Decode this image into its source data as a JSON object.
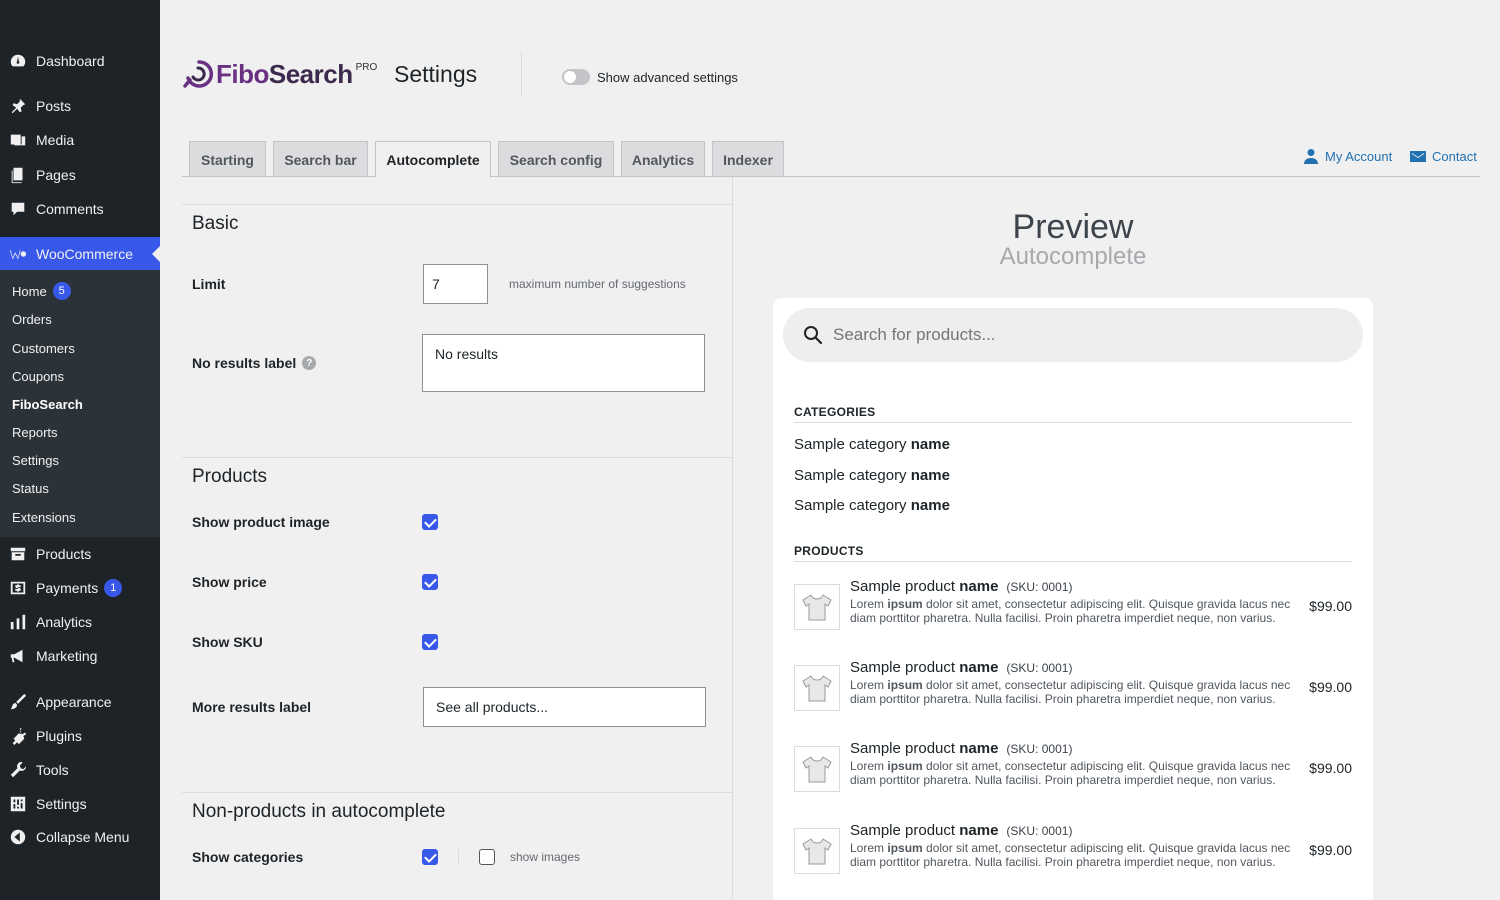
{
  "sidebar": {
    "items": [
      {
        "label": "Dashboard",
        "icon": "dashboard-icon"
      },
      {
        "label": "Posts",
        "icon": "pin-icon"
      },
      {
        "label": "Media",
        "icon": "media-icon"
      },
      {
        "label": "Pages",
        "icon": "pages-icon"
      },
      {
        "label": "Comments",
        "icon": "comment-icon"
      },
      {
        "label": "WooCommerce",
        "icon": "woo-icon"
      },
      {
        "label": "Products",
        "icon": "archive-icon"
      },
      {
        "label": "Payments",
        "icon": "dollar-icon",
        "badge": "1"
      },
      {
        "label": "Analytics",
        "icon": "bar-chart-icon"
      },
      {
        "label": "Marketing",
        "icon": "megaphone-icon"
      },
      {
        "label": "Appearance",
        "icon": "paint-brush-icon"
      },
      {
        "label": "Plugins",
        "icon": "plug-icon"
      },
      {
        "label": "Tools",
        "icon": "wrench-icon"
      },
      {
        "label": "Settings",
        "icon": "sliders-icon"
      },
      {
        "label": "Collapse Menu",
        "icon": "collapse-icon"
      }
    ],
    "submenu": [
      {
        "label": "Home",
        "badge": "5"
      },
      {
        "label": "Orders"
      },
      {
        "label": "Customers"
      },
      {
        "label": "Coupons"
      },
      {
        "label": "FiboSearch"
      },
      {
        "label": "Reports"
      },
      {
        "label": "Settings"
      },
      {
        "label": "Status"
      },
      {
        "label": "Extensions"
      }
    ]
  },
  "header": {
    "brand_part1": "Fibo",
    "brand_part2": "Search",
    "pro": "PRO",
    "title": "Settings",
    "advanced_toggle_label": "Show advanced settings"
  },
  "tabs": [
    "Starting",
    "Search bar",
    "Autocomplete",
    "Search config",
    "Analytics",
    "Indexer"
  ],
  "top_links": {
    "account": "My Account",
    "contact": "Contact"
  },
  "settings": {
    "basic": {
      "title": "Basic",
      "limit_label": "Limit",
      "limit_value": "7",
      "limit_hint": "maximum number of suggestions",
      "no_results_label": "No results label",
      "no_results_value": "No results"
    },
    "products": {
      "title": "Products",
      "show_image": "Show product image",
      "show_price": "Show price",
      "show_sku": "Show SKU",
      "more_results_label": "More results label",
      "more_results_value": "See all products..."
    },
    "non_products": {
      "title": "Non-products in autocomplete",
      "show_categories": "Show categories",
      "show_images": "show images"
    }
  },
  "preview": {
    "title": "Preview",
    "subtitle": "Autocomplete",
    "search_placeholder": "Search for products...",
    "categories_head": "CATEGORIES",
    "category_prefix": "Sample category ",
    "category_bold": "name",
    "products_head": "PRODUCTS",
    "product_prefix": "Sample product ",
    "product_bold": "name",
    "sku": "(SKU: 0001)",
    "desc_lead": "Lorem ",
    "desc_bold": "ipsum",
    "desc_rest": " dolor sit amet, consectetur adipiscing elit. Quisque gravida lacus nec diam porttitor pharetra. Nulla facilisi. Proin pharetra imperdiet neque, non varius.",
    "price": "$99.00"
  },
  "colors": {
    "accent": "#3858e9",
    "sidebar_bg": "#1d2327",
    "submenu_bg": "#2c3338",
    "brand": "#6a3082"
  }
}
